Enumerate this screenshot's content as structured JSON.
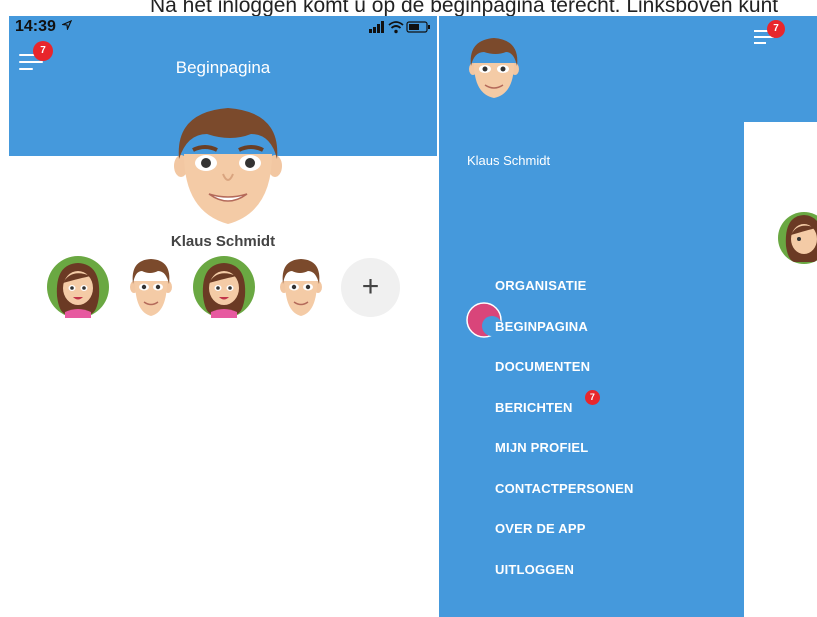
{
  "caption": "Na het inloggen komt u op de beginpagina terecht. Linksboven kunt",
  "status": {
    "time": "14:39"
  },
  "home": {
    "title": "Beginpagina",
    "badge_count": "7",
    "user_name": "Klaus Schmidt",
    "add_symbol": "+"
  },
  "drawer": {
    "badge_count": "7",
    "user_name": "Klaus Schmidt",
    "items": [
      {
        "label": "ORGANISATIE"
      },
      {
        "label": "BEGINPAGINA"
      },
      {
        "label": "DOCUMENTEN"
      },
      {
        "label": "BERICHTEN",
        "badge": "7"
      },
      {
        "label": "MIJN PROFIEL"
      },
      {
        "label": "CONTACTPERSONEN"
      },
      {
        "label": "OVER DE APP"
      },
      {
        "label": "UITLOGGEN"
      }
    ]
  },
  "colors": {
    "accent": "#4599dc",
    "badge": "#e8262c",
    "indicator": "#d9457a"
  },
  "icons": [
    "hamburger-menu-icon",
    "add-icon",
    "location-arrow-icon",
    "signal-icon",
    "wifi-icon",
    "battery-icon"
  ]
}
